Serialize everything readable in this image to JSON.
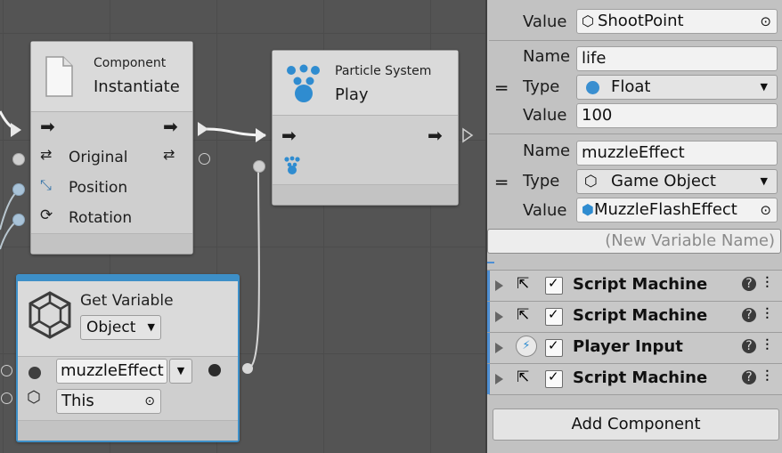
{
  "nodes": {
    "instantiate": {
      "category": "Component",
      "title": "Instantiate",
      "ports": [
        "Original",
        "Position",
        "Rotation"
      ]
    },
    "particle": {
      "category": "Particle System",
      "title": "Play"
    },
    "get_variable": {
      "title": "Get Variable",
      "kind": "Object",
      "name_value": "muzzleEffect",
      "target_value": "This"
    }
  },
  "inspector": {
    "top_value": {
      "label": "Value",
      "value": "ShootPoint"
    },
    "life_var": {
      "name_label": "Name",
      "name": "life",
      "type_label": "Type",
      "type": "Float",
      "value_label": "Value",
      "value": "100"
    },
    "muzzle_var": {
      "name_label": "Name",
      "name": "muzzleEffect",
      "type_label": "Type",
      "type": "Game Object",
      "value_label": "Value",
      "value": "MuzzleFlashEffect"
    },
    "new_variable_placeholder": "(New Variable Name)",
    "components": [
      {
        "title": "Script Machine"
      },
      {
        "title": "Script Machine"
      },
      {
        "title": "Player Input"
      },
      {
        "title": "Script Machine"
      }
    ],
    "add_component": "Add Component"
  },
  "colors": {
    "accent_blue": "#3a8fd0",
    "graph_bg": "#545454",
    "inspector_bg": "#c2c2c2"
  }
}
